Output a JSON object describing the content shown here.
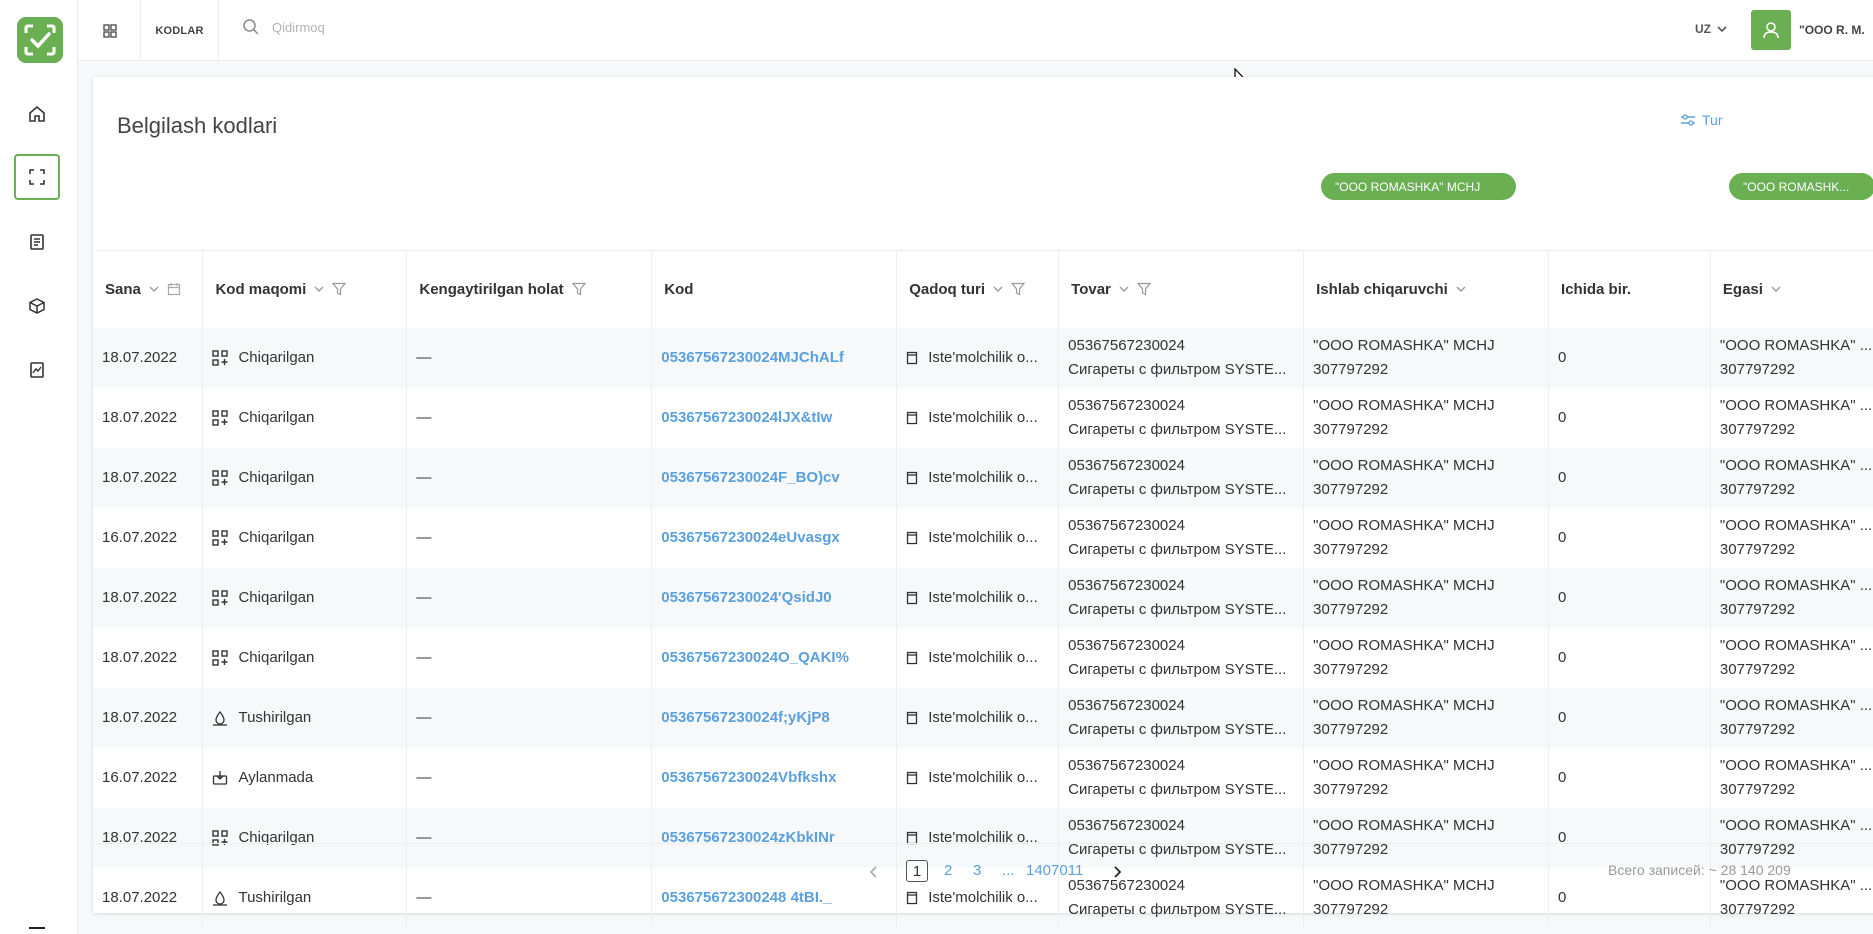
{
  "app": {
    "section": "KODLAR",
    "search_placeholder": "Qidirmoq",
    "language": "UZ",
    "user": "\"OOO R. M."
  },
  "sidebar": {
    "items": [
      {
        "name": "home",
        "icon": "home-icon"
      },
      {
        "name": "codes",
        "icon": "scan-icon",
        "active": true
      },
      {
        "name": "documents",
        "icon": "document-icon"
      },
      {
        "name": "products",
        "icon": "box-icon"
      },
      {
        "name": "reports",
        "icon": "chart-icon"
      }
    ]
  },
  "page": {
    "title": "Belgilash kodlari",
    "type_filter_label": "Tur"
  },
  "filter_pills": {
    "manufacturer": "\"OOO ROMASHKA\" MCHJ",
    "owner": "\"OOO ROMASHK..."
  },
  "table": {
    "columns": {
      "date": "Sana",
      "status": "Kod maqomi",
      "extended": "Kengaytirilgan holat",
      "code": "Kod",
      "package": "Qadoq turi",
      "product": "Tovar",
      "manufacturer": "Ishlab chiqaruvchi",
      "inside": "Ichida bir.",
      "owner": "Egasi"
    },
    "rows": [
      {
        "date": "18.07.2022",
        "status": "Chiqarilgan",
        "status_icon": "qr-add-icon",
        "extended": "—",
        "code": "05367567230024MJChALf",
        "package": "Iste'molchilik o...",
        "gtin": "05367567230024",
        "product": "Сигареты с фильтром SYSTE...",
        "manufacturer": "\"OOO ROMASHKA\" MCHJ",
        "tin": "307797292",
        "inside": "0",
        "owner": "\"OOO ROMASHKA\" ...",
        "owner_tin": "307797292"
      },
      {
        "date": "18.07.2022",
        "status": "Chiqarilgan",
        "status_icon": "qr-add-icon",
        "extended": "—",
        "code": "05367567230024lJX&tIw",
        "package": "Iste'molchilik o...",
        "gtin": "05367567230024",
        "product": "Сигареты с фильтром SYSTE...",
        "manufacturer": "\"OOO ROMASHKA\" MCHJ",
        "tin": "307797292",
        "inside": "0",
        "owner": "\"OOO ROMASHKA\" ...",
        "owner_tin": "307797292"
      },
      {
        "date": "18.07.2022",
        "status": "Chiqarilgan",
        "status_icon": "qr-add-icon",
        "extended": "—",
        "code": "05367567230024F_BO)cv",
        "package": "Iste'molchilik o...",
        "gtin": "05367567230024",
        "product": "Сигареты с фильтром SYSTE...",
        "manufacturer": "\"OOO ROMASHKA\" MCHJ",
        "tin": "307797292",
        "inside": "0",
        "owner": "\"OOO ROMASHKA\" ...",
        "owner_tin": "307797292"
      },
      {
        "date": "16.07.2022",
        "status": "Chiqarilgan",
        "status_icon": "qr-add-icon",
        "extended": "—",
        "code": "05367567230024eUvasgx",
        "package": "Iste'molchilik o...",
        "gtin": "05367567230024",
        "product": "Сигареты с фильтром SYSTE...",
        "manufacturer": "\"OOO ROMASHKA\" MCHJ",
        "tin": "307797292",
        "inside": "0",
        "owner": "\"OOO ROMASHKA\" ...",
        "owner_tin": "307797292"
      },
      {
        "date": "18.07.2022",
        "status": "Chiqarilgan",
        "status_icon": "qr-add-icon",
        "extended": "—",
        "code": "05367567230024'QsidJ0",
        "package": "Iste'molchilik o...",
        "gtin": "05367567230024",
        "product": "Сигареты с фильтром SYSTE...",
        "manufacturer": "\"OOO ROMASHKA\" MCHJ",
        "tin": "307797292",
        "inside": "0",
        "owner": "\"OOO ROMASHKA\" ...",
        "owner_tin": "307797292"
      },
      {
        "date": "18.07.2022",
        "status": "Chiqarilgan",
        "status_icon": "qr-add-icon",
        "extended": "—",
        "code": "05367567230024O_QAKI%",
        "package": "Iste'molchilik o...",
        "gtin": "05367567230024",
        "product": "Сигареты с фильтром SYSTE...",
        "manufacturer": "\"OOO ROMASHKA\" MCHJ",
        "tin": "307797292",
        "inside": "0",
        "owner": "\"OOO ROMASHKA\" ...",
        "owner_tin": "307797292"
      },
      {
        "date": "18.07.2022",
        "status": "Tushirilgan",
        "status_icon": "drop-icon",
        "extended": "—",
        "code": "05367567230024f;yKjP8",
        "package": "Iste'molchilik o...",
        "gtin": "05367567230024",
        "product": "Сигареты с фильтром SYSTE...",
        "manufacturer": "\"OOO ROMASHKA\" MCHJ",
        "tin": "307797292",
        "inside": "0",
        "owner": "\"OOO ROMASHKA\" ...",
        "owner_tin": "307797292"
      },
      {
        "date": "16.07.2022",
        "status": "Aylanmada",
        "status_icon": "circulation-icon",
        "extended": "—",
        "code": "05367567230024Vbfkshx",
        "package": "Iste'molchilik o...",
        "gtin": "05367567230024",
        "product": "Сигареты с фильтром SYSTE...",
        "manufacturer": "\"OOO ROMASHKA\" MCHJ",
        "tin": "307797292",
        "inside": "0",
        "owner": "\"OOO ROMASHKA\" ...",
        "owner_tin": "307797292"
      },
      {
        "date": "18.07.2022",
        "status": "Chiqarilgan",
        "status_icon": "qr-add-icon",
        "extended": "—",
        "code": "05367567230024zKbkINr",
        "package": "Iste'molchilik o...",
        "gtin": "05367567230024",
        "product": "Сигареты с фильтром SYSTE...",
        "manufacturer": "\"OOO ROMASHKA\" MCHJ",
        "tin": "307797292",
        "inside": "0",
        "owner": "\"OOO ROMASHKA\" ...",
        "owner_tin": "307797292"
      },
      {
        "date": "18.07.2022",
        "status": "Tushirilgan",
        "status_icon": "drop-icon",
        "extended": "—",
        "code": "053675672300248 4tBI._",
        "package": "Iste'molchilik o...",
        "gtin": "05367567230024",
        "product": "Сигареты с фильтром SYSTE...",
        "manufacturer": "\"OOO ROMASHKA\" MCHJ",
        "tin": "307797292",
        "inside": "0",
        "owner": "\"OOO ROMASHKA\" ...",
        "owner_tin": "307797292"
      }
    ]
  },
  "pagination": {
    "pages": [
      "1",
      "2",
      "3"
    ],
    "ellipsis": "...",
    "last_page": "1407011",
    "total": "Всего записей: ~ 28 140 209"
  }
}
